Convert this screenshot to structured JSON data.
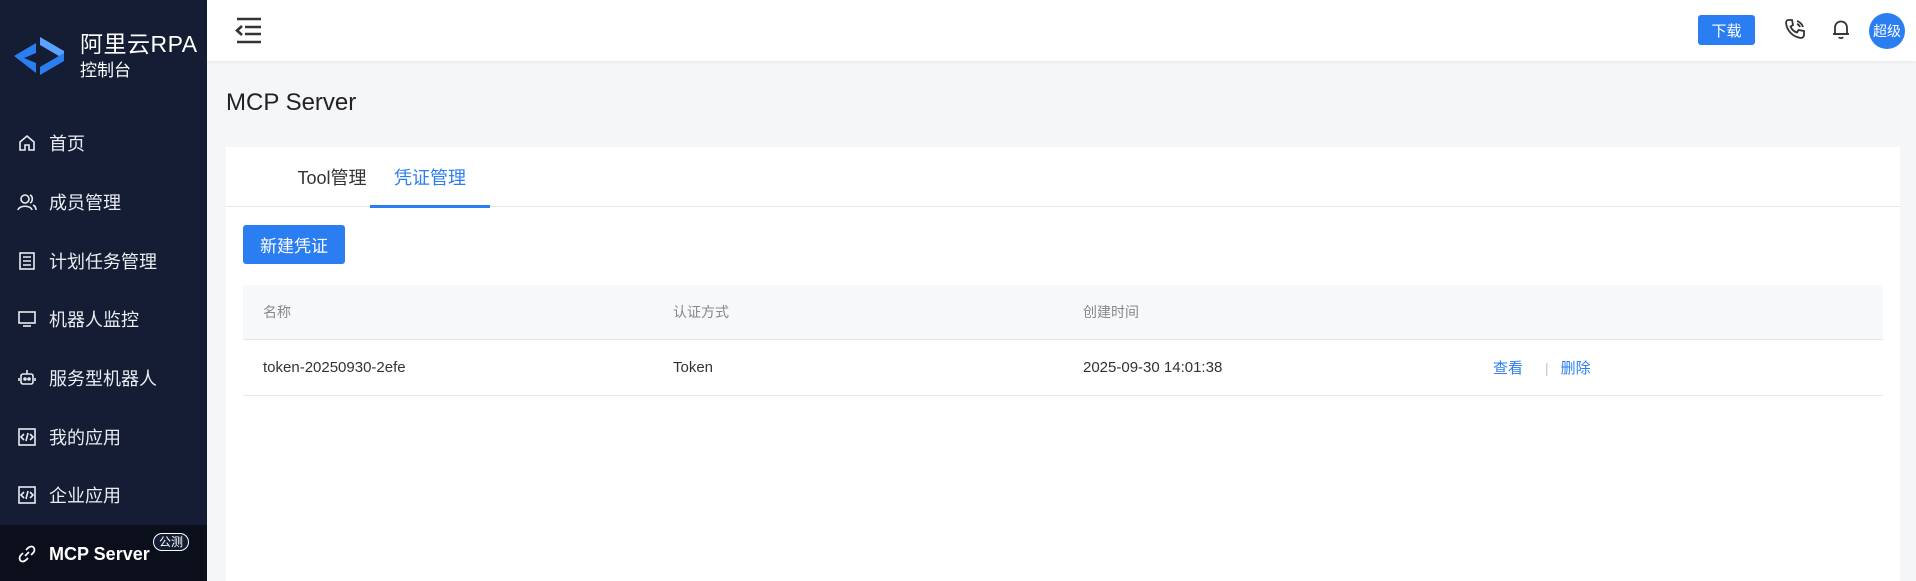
{
  "app": {
    "logo_title": "阿里云RPA",
    "logo_subtitle": "控制台",
    "brand_color": "#2a7ef2",
    "sidebar_bg": "#141d33"
  },
  "sidebar": {
    "items": [
      {
        "label": "首页",
        "icon": "home-icon"
      },
      {
        "label": "成员管理",
        "icon": "members-icon"
      },
      {
        "label": "计划任务管理",
        "icon": "task-list-icon"
      },
      {
        "label": "机器人监控",
        "icon": "monitor-icon"
      },
      {
        "label": "服务型机器人",
        "icon": "robot-icon"
      },
      {
        "label": "我的应用",
        "icon": "code-app-icon"
      },
      {
        "label": "企业应用",
        "icon": "code-app-icon"
      },
      {
        "label": "MCP Server",
        "icon": "link-icon",
        "badge": "公测",
        "active": true
      }
    ]
  },
  "header": {
    "download_label": "下载",
    "avatar_text": "超级",
    "icons": [
      "menu-toggle-icon",
      "phone-icon",
      "bell-icon"
    ]
  },
  "page": {
    "title": "MCP Server",
    "tabs": [
      {
        "label": "Tool管理",
        "active": false
      },
      {
        "label": "凭证管理",
        "active": true
      }
    ],
    "new_button": "新建凭证"
  },
  "table": {
    "columns": [
      "名称",
      "认证方式",
      "创建时间",
      ""
    ],
    "rows": [
      {
        "name": "token-20250930-2efe",
        "auth": "Token",
        "created": "2025-09-30 14:01:38",
        "actions": [
          "查看",
          "|",
          "删除"
        ]
      }
    ]
  }
}
